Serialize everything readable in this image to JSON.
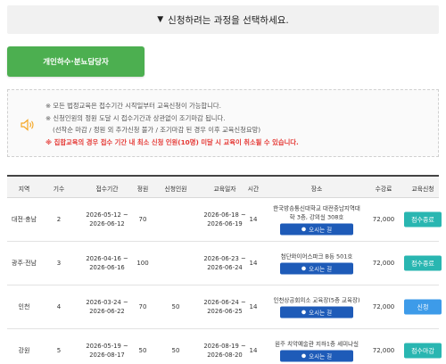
{
  "banner": {
    "text": "신청하려는 과정을 선택하세요."
  },
  "course_button": {
    "label": "개인하수·분뇨담당자"
  },
  "notice": {
    "line1": "※ 모든 법정교육은 접수기간 시작일부터 교육신청이 가능합니다.",
    "line2": "※ 신청인원의 정원 도달 시 접수기간과 상관없이 조기마감 됩니다.",
    "line3": "(선착순 마감 / 정원 외 추가신청 불가 / 조기마감 된 경우 이후 교육신청요망)",
    "line4": "※ 집합교육의 경우 접수 기간 내 최소 신청 인원(10명) 미달 시 교육이 취소될 수 있습니다."
  },
  "table": {
    "headers": {
      "region": "지역",
      "term": "기수",
      "period": "접수기간",
      "quota": "정원",
      "applied": "신청인원",
      "edu_date": "교육일자",
      "time": "시간",
      "place": "장소",
      "fee": "수강료",
      "status": "교육신청"
    },
    "rows": [
      {
        "region": "대전·충남",
        "term": "2",
        "period_start": "2026-05-12 ~",
        "period_end": "2026-06-12",
        "quota": "70",
        "applied": "",
        "edu_start": "2026-06-18 ~",
        "edu_end": "2026-06-19",
        "time": "14",
        "place_line1": "한국방송통신대학교 대전충남지역대",
        "place_line2": "학 3층, 강의실 308호",
        "place_btn": "오시는 길",
        "fee": "72,000",
        "status": "접수종료"
      },
      {
        "region": "광주·전남",
        "term": "3",
        "period_start": "2026-04-16 ~",
        "period_end": "2026-06-16",
        "quota": "100",
        "applied": "",
        "edu_start": "2026-06-23 ~",
        "edu_end": "2026-06-24",
        "time": "14",
        "place_line1": "첨단와이어스파크 B동 501호",
        "place_line2": "",
        "place_btn": "오시는 길",
        "fee": "72,000",
        "status": "접수종료"
      },
      {
        "region": "인천",
        "term": "4",
        "period_start": "2026-03-24 ~",
        "period_end": "2026-06-22",
        "quota": "70",
        "applied": "50",
        "edu_start": "2026-06-24 ~",
        "edu_end": "2026-06-25",
        "time": "14",
        "place_line1": "인천상공회의소 교육장(5층 교육장)",
        "place_line2": "",
        "place_btn": "오시는 길",
        "fee": "72,000",
        "status": "신청"
      },
      {
        "region": "강원",
        "term": "5",
        "period_start": "2026-05-19 ~",
        "period_end": "2026-08-17",
        "quota": "50",
        "applied": "50",
        "edu_start": "2026-08-19 ~",
        "edu_end": "2026-08-20",
        "time": "14",
        "place_line1": "원주 치악예술관 지하1층 세미나실",
        "place_line2": "",
        "place_btn": "오시는 길",
        "fee": "72,000",
        "status": "접수마감"
      }
    ]
  },
  "colors": {
    "course_button": "#4caf50",
    "status_closed": "#29b6b1",
    "status_apply": "#3d9be9",
    "place_button": "#1e5bb8",
    "warning": "#e53935"
  }
}
